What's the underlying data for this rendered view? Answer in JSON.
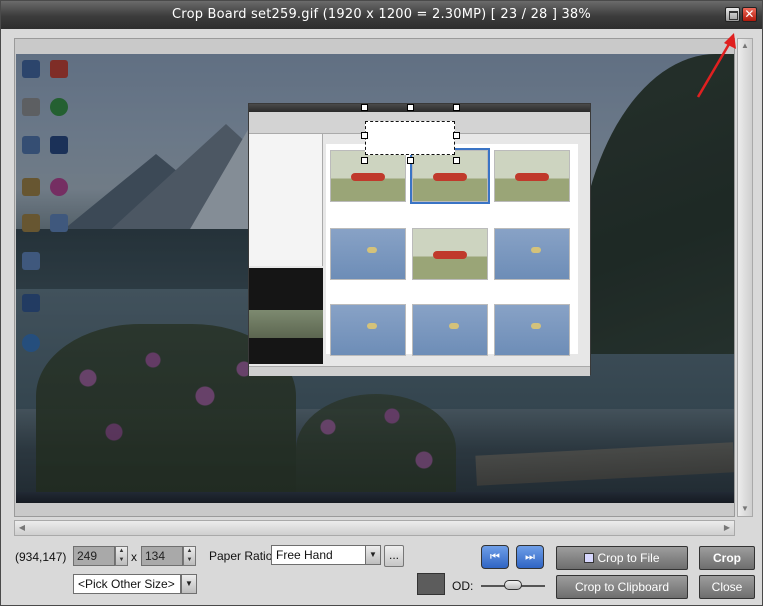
{
  "window": {
    "title": "Crop Board   set259.gif  (1920 x 1200 = 2.30MP)  [ 23 / 28 ]   38%",
    "close_glyph": "✕",
    "restore_icon": "restore-icon",
    "close_icon": "close-icon"
  },
  "status": {
    "coords": "(934,147)"
  },
  "size": {
    "width": "249",
    "height": "134",
    "separator": "x",
    "pick_other_size": "<Pick Other Size>"
  },
  "paper": {
    "label": "Paper Ratio:",
    "value": "Free Hand",
    "more_label": "..."
  },
  "nav": {
    "prev_glyph": "⏮",
    "next_glyph": "⏭"
  },
  "buttons": {
    "crop_to_file": "Crop to File",
    "crop_to_clipboard": "Crop to Clipboard",
    "crop": "Crop",
    "close": "Close"
  },
  "od": {
    "label": "OD:"
  },
  "colors": {
    "titlebar": "#3b3b3b",
    "annotation_arrow": "#e02020",
    "nav_button": "#2f64c4"
  }
}
